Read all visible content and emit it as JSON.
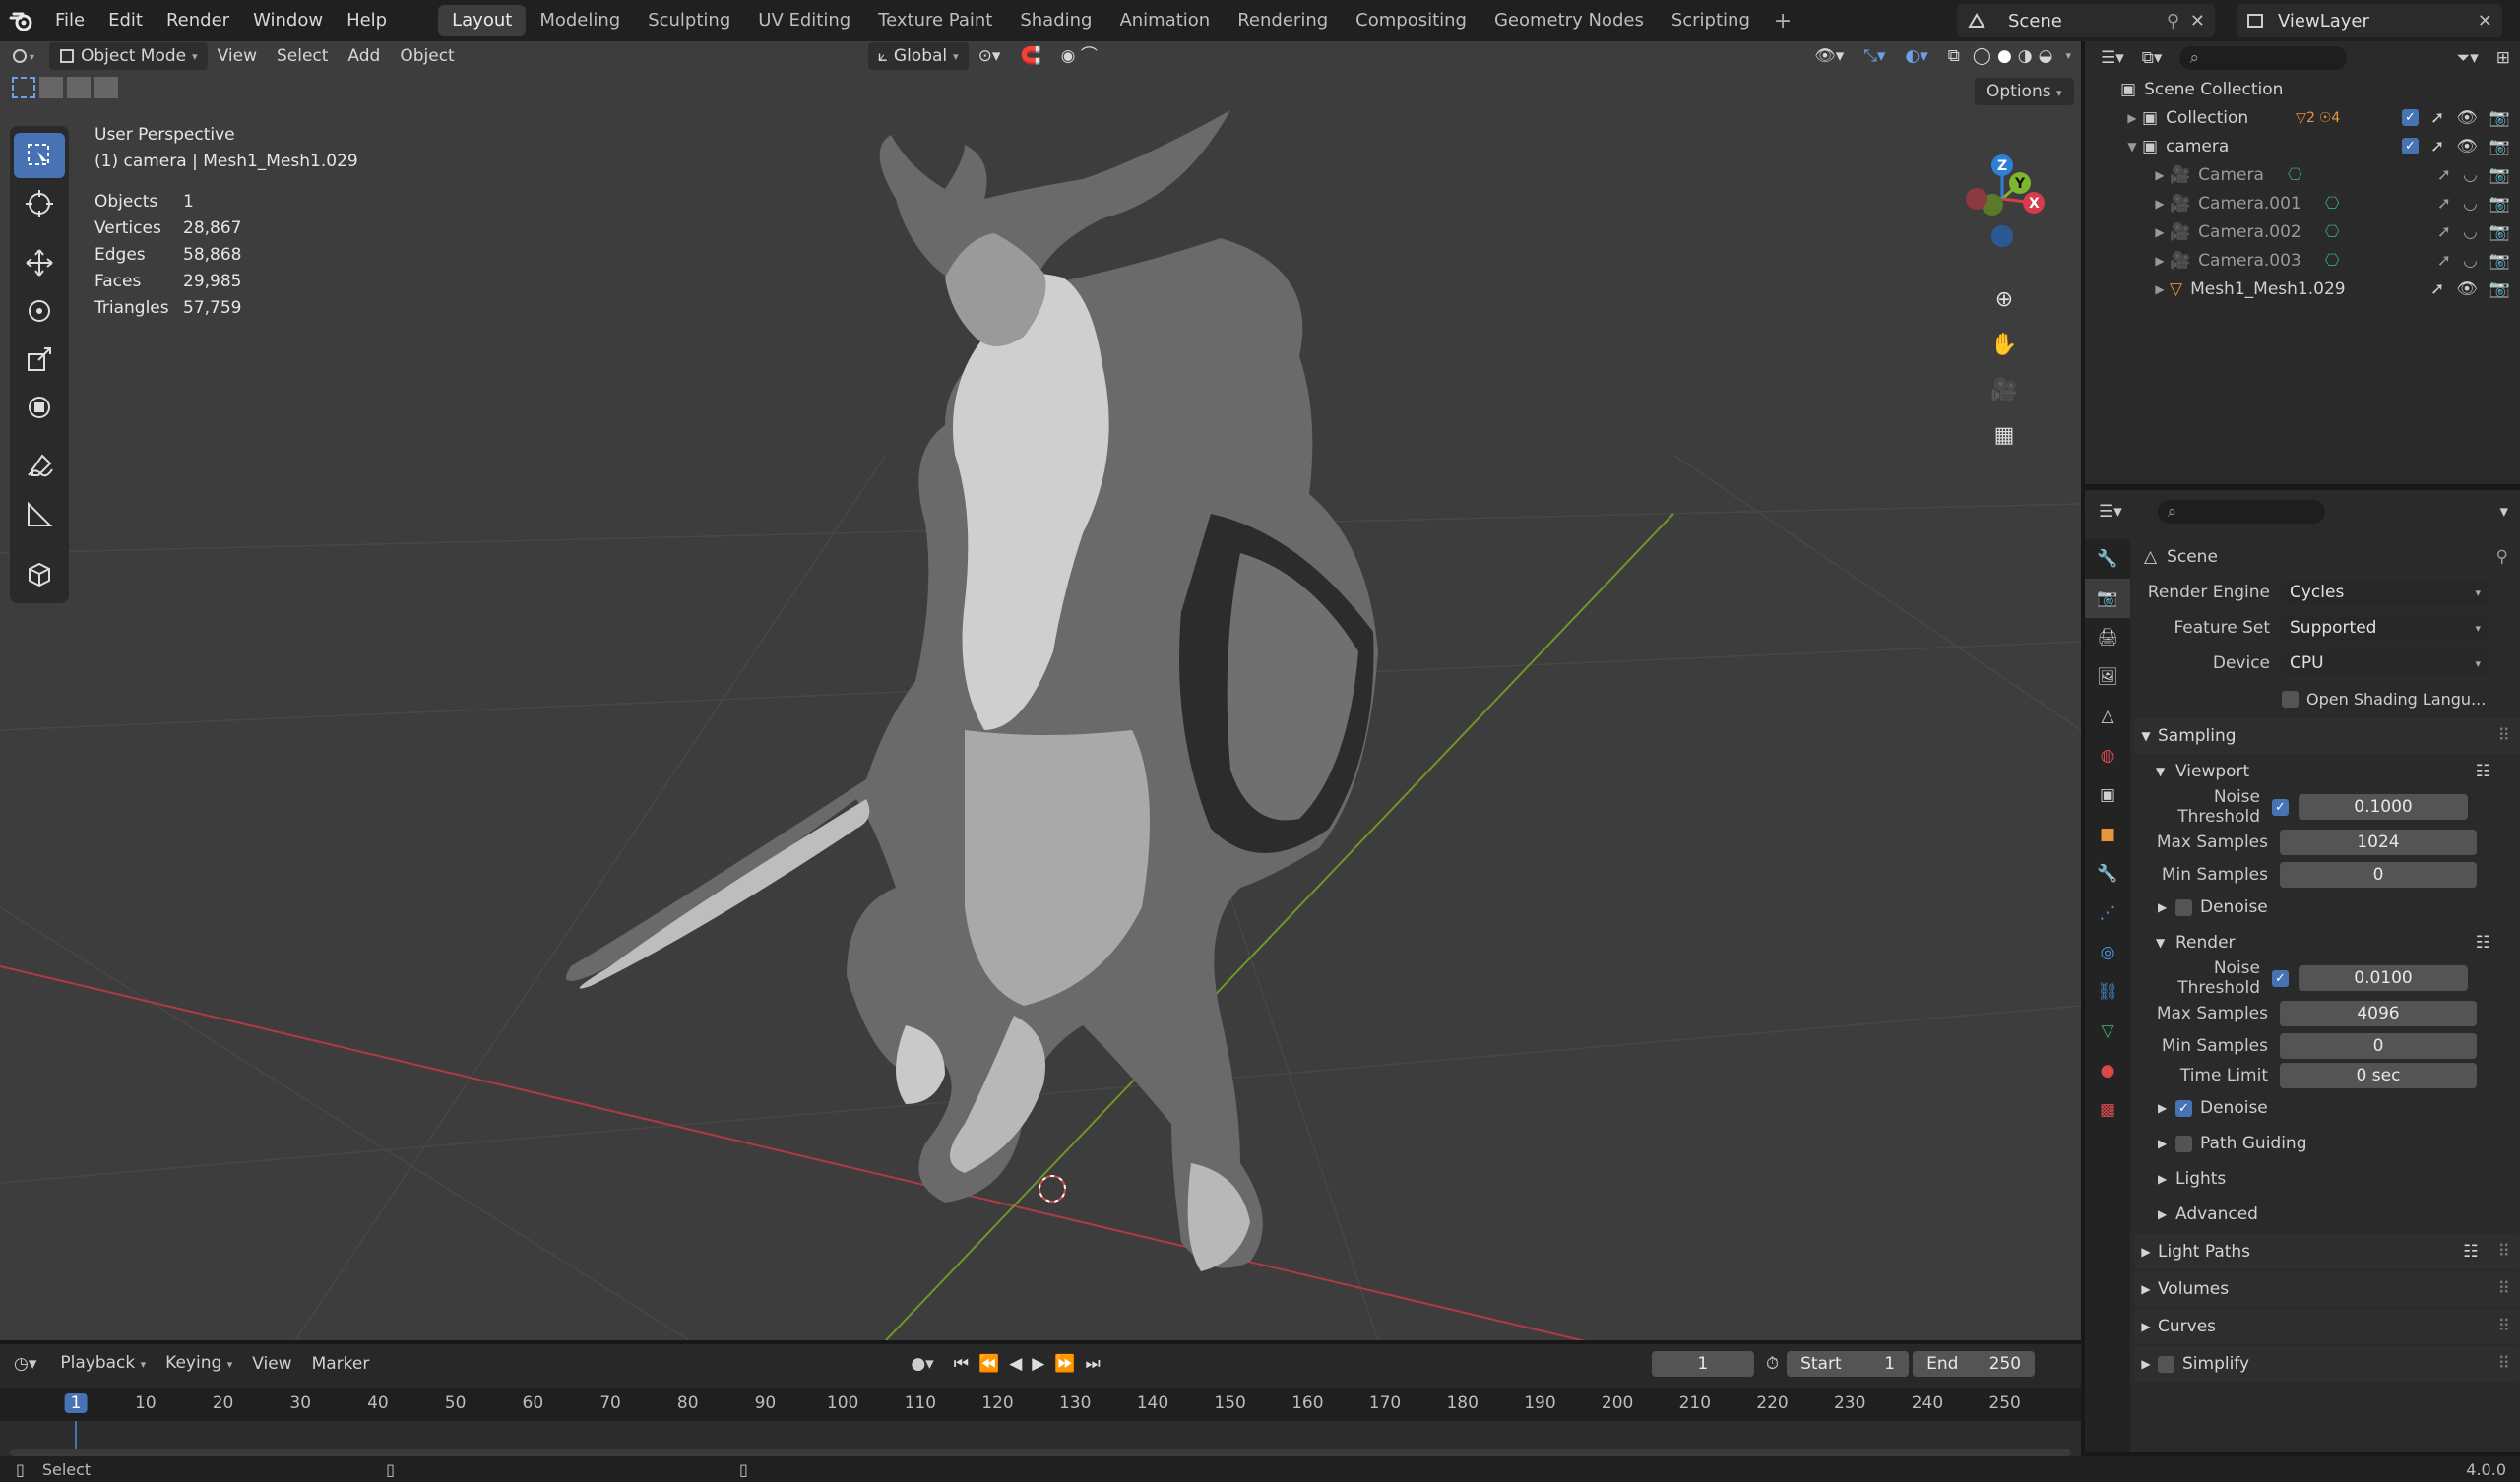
{
  "top_menu": [
    "File",
    "Edit",
    "Render",
    "Window",
    "Help"
  ],
  "workspaces": [
    "Layout",
    "Modeling",
    "Sculpting",
    "UV Editing",
    "Texture Paint",
    "Shading",
    "Animation",
    "Rendering",
    "Compositing",
    "Geometry Nodes",
    "Scripting"
  ],
  "active_workspace": "Layout",
  "scene_name": "Scene",
  "view_layer": "ViewLayer",
  "viewport": {
    "mode": "Object Mode",
    "menus": [
      "View",
      "Select",
      "Add",
      "Object"
    ],
    "orientation": "Global",
    "options_label": "Options",
    "view_name": "User Perspective",
    "object_info": "(1) camera | Mesh1_Mesh1.029",
    "stats": [
      {
        "label": "Objects",
        "value": "1"
      },
      {
        "label": "Vertices",
        "value": "28,867"
      },
      {
        "label": "Edges",
        "value": "58,868"
      },
      {
        "label": "Faces",
        "value": "29,985"
      },
      {
        "label": "Triangles",
        "value": "57,759"
      }
    ],
    "gizmo_axes": {
      "z": "Z",
      "y": "Y",
      "x": "X"
    }
  },
  "outliner": {
    "root": "Scene Collection",
    "rows": [
      {
        "name": "Collection",
        "depth": 1,
        "expanded": false
      },
      {
        "name": "camera",
        "depth": 1,
        "expanded": true
      },
      {
        "name": "Camera",
        "depth": 2,
        "expanded": false
      },
      {
        "name": "Camera.001",
        "depth": 2,
        "expanded": false
      },
      {
        "name": "Camera.002",
        "depth": 2,
        "expanded": false
      },
      {
        "name": "Camera.003",
        "depth": 2,
        "expanded": false
      },
      {
        "name": "Mesh1_Mesh1.029",
        "depth": 2,
        "expanded": false
      }
    ],
    "collection_counts": {
      "mesh": "2",
      "light": "4"
    }
  },
  "properties": {
    "context": "Scene",
    "render_engine_label": "Render Engine",
    "render_engine": "Cycles",
    "feature_set_label": "Feature Set",
    "feature_set": "Supported",
    "device_label": "Device",
    "device": "CPU",
    "osl_label": "Open Shading Langu...",
    "sampling": "Sampling",
    "viewport_section": "Viewport",
    "viewport_noise_label": "Noise Threshold",
    "viewport_noise": "0.1000",
    "viewport_max_label": "Max Samples",
    "viewport_max": "1024",
    "viewport_min_label": "Min Samples",
    "viewport_min": "0",
    "denoise": "Denoise",
    "render_section": "Render",
    "render_noise_label": "Noise Threshold",
    "render_noise": "0.0100",
    "render_max_label": "Max Samples",
    "render_max": "4096",
    "render_min_label": "Min Samples",
    "render_min": "0",
    "time_limit_label": "Time Limit",
    "time_limit": "0 sec",
    "render_denoise": "Denoise",
    "path_guiding": "Path Guiding",
    "lights": "Lights",
    "advanced": "Advanced",
    "light_paths": "Light Paths",
    "volumes": "Volumes",
    "curves": "Curves",
    "simplify": "Simplify"
  },
  "timeline": {
    "menus": [
      "Playback",
      "Keying",
      "View",
      "Marker"
    ],
    "current_frame": "1",
    "start_label": "Start",
    "start": "1",
    "end_label": "End",
    "end": "250",
    "ticks": [
      "1",
      "10",
      "20",
      "30",
      "40",
      "50",
      "60",
      "70",
      "80",
      "90",
      "100",
      "110",
      "120",
      "130",
      "140",
      "150",
      "160",
      "170",
      "180",
      "190",
      "200",
      "210",
      "220",
      "230",
      "240",
      "250"
    ]
  },
  "status": {
    "left": "Select",
    "version": "4.0.0"
  },
  "colors": {
    "accent": "#4772b3",
    "x_axis": "#d63c4a",
    "y_axis": "#7fb52c",
    "z_axis": "#2f7fd6",
    "viewport_bg": "#3d3d3d"
  }
}
